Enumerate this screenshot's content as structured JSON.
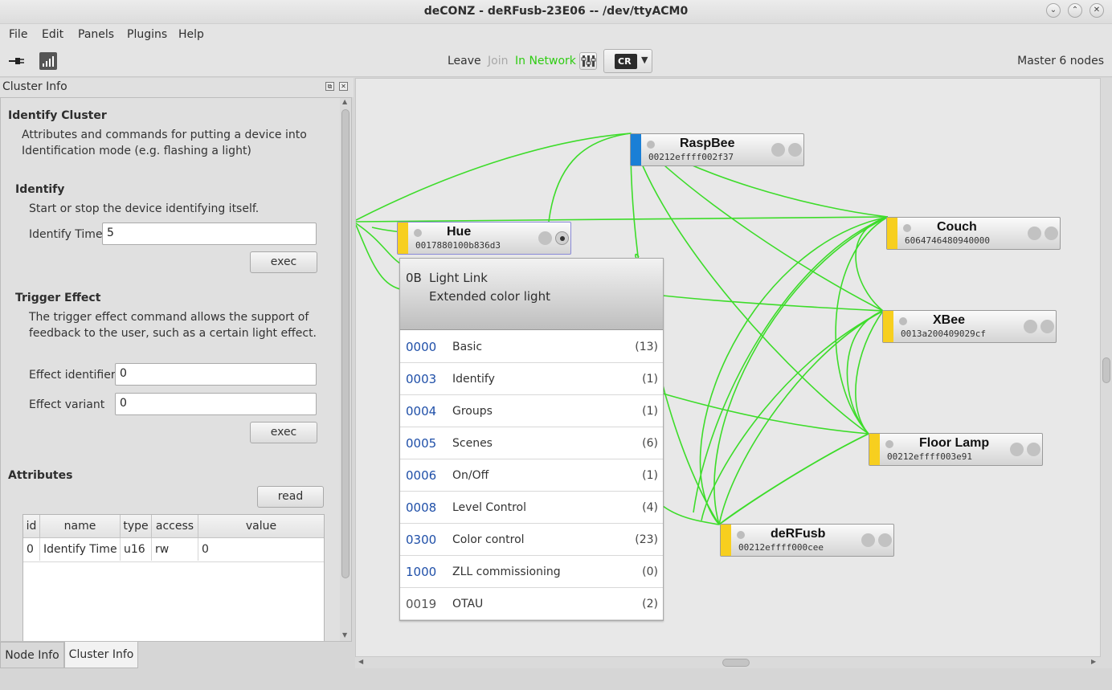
{
  "window": {
    "title": "deCONZ - deRFusb-23E06 -- /dev/ttyACM0"
  },
  "menu": [
    "File",
    "Edit",
    "Panels",
    "Plugins",
    "Help"
  ],
  "toolbar": {
    "leave": "Leave",
    "join": "Join",
    "in_network": "In Network",
    "cr_label": "CR",
    "status": "Master 6 nodes",
    "in_network_color": "#2ecc12"
  },
  "dock": {
    "title": "Cluster Info"
  },
  "cluster": {
    "title": "Identify Cluster",
    "description": [
      "Attributes and commands for putting a device into",
      "Identification mode (e.g. flashing a light)"
    ],
    "identify": {
      "heading": "Identify",
      "description": "Start or stop the device identifying itself.",
      "time_label": "Identify Time",
      "time_value": "5",
      "exec_label": "exec"
    },
    "trigger": {
      "heading": "Trigger Effect",
      "description": [
        "The trigger effect command allows the support of",
        "feedback to the user, such as a certain light effect."
      ],
      "effect_id_label": "Effect identifier",
      "effect_id_value": "0",
      "effect_variant_label": "Effect variant",
      "effect_variant_value": "0",
      "exec_label": "exec"
    },
    "attributes": {
      "heading": "Attributes",
      "read_label": "read",
      "columns": [
        "id",
        "name",
        "type",
        "access",
        "value"
      ],
      "rows": [
        [
          "0",
          "Identify Time",
          "u16",
          "rw",
          "0"
        ]
      ]
    }
  },
  "tabs": [
    "Node Info",
    "Cluster Info"
  ],
  "nodes": [
    {
      "name": "RaspBee",
      "mac": "00212effff002f37",
      "color": "#1a7fd6"
    },
    {
      "name": "Hue",
      "mac": "0017880100b836d3",
      "color": "#f7cf1f"
    },
    {
      "name": "Couch",
      "mac": "6064746480940000",
      "color": "#f7cf1f"
    },
    {
      "name": "XBee",
      "mac": "0013a200409029cf",
      "color": "#f7cf1f"
    },
    {
      "name": "Floor Lamp",
      "mac": "00212effff003e91",
      "color": "#f7cf1f"
    },
    {
      "name": "deRFusb",
      "mac": "00212effff000cee",
      "color": "#f7cf1f"
    }
  ],
  "endpoint": {
    "id": "0B",
    "profile": "Light Link",
    "device": "Extended color light",
    "clusters": [
      {
        "id": "0000",
        "name": "Basic",
        "count": "(13)"
      },
      {
        "id": "0003",
        "name": "Identify",
        "count": "(1)"
      },
      {
        "id": "0004",
        "name": "Groups",
        "count": "(1)"
      },
      {
        "id": "0005",
        "name": "Scenes",
        "count": "(6)"
      },
      {
        "id": "0006",
        "name": "On/Off",
        "count": "(1)"
      },
      {
        "id": "0008",
        "name": "Level Control",
        "count": "(4)"
      },
      {
        "id": "0300",
        "name": "Color control",
        "count": "(23)"
      },
      {
        "id": "1000",
        "name": "ZLL commissioning",
        "count": "(0)"
      },
      {
        "id": "0019",
        "name": "OTAU",
        "count": "(2)"
      }
    ]
  },
  "colors": {
    "link": "#3ddc2a",
    "cluster_id_server": "#1f4fa8",
    "cluster_id_client": "#555555"
  }
}
